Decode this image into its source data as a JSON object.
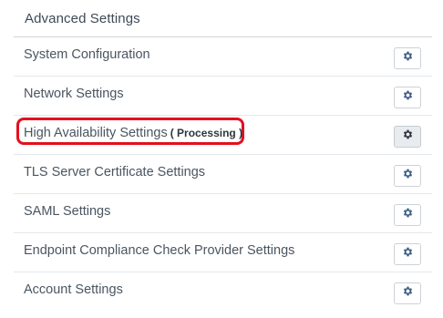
{
  "panel": {
    "title": "Advanced Settings"
  },
  "colors": {
    "highlight_border": "#e3101f",
    "gear_icon": "#3f5f85"
  },
  "settings": [
    {
      "label": "System Configuration",
      "status": "",
      "icon": "gear-icon"
    },
    {
      "label": "Network Settings",
      "status": "",
      "icon": "gear-icon"
    },
    {
      "label": "High Availability Settings",
      "status": "( Processing )",
      "icon": "gear-icon"
    },
    {
      "label": "TLS Server Certificate Settings",
      "status": "",
      "icon": "gear-icon"
    },
    {
      "label": "SAML Settings",
      "status": "",
      "icon": "gear-icon"
    },
    {
      "label": "Endpoint Compliance Check Provider Settings",
      "status": "",
      "icon": "gear-icon"
    },
    {
      "label": "Account Settings",
      "status": "",
      "icon": "gear-icon"
    }
  ]
}
